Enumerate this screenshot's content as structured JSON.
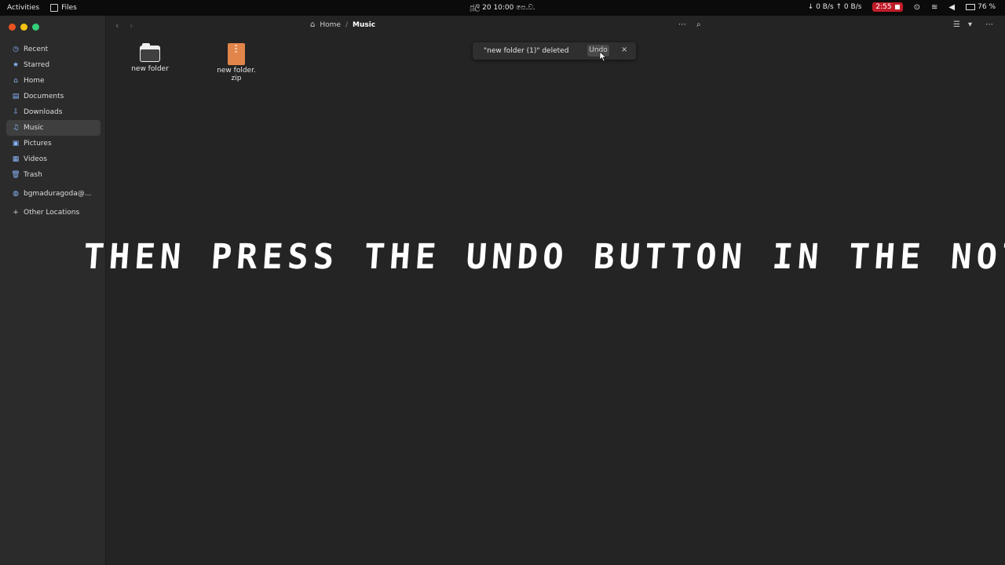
{
  "topbar": {
    "activities": "Activities",
    "app_name": "Files",
    "clock": "ජූලි 20  10:00 පෙ.ව.",
    "net_speed": "↓ 0 B/s  ↑ 0 B/s",
    "rec_time": "2:55",
    "battery": "76 %"
  },
  "sidebar": {
    "items": [
      {
        "label": "Recent",
        "icon": "clock-icon"
      },
      {
        "label": "Starred",
        "icon": "star-icon"
      },
      {
        "label": "Home",
        "icon": "home-icon"
      },
      {
        "label": "Documents",
        "icon": "document-icon"
      },
      {
        "label": "Downloads",
        "icon": "download-icon"
      },
      {
        "label": "Music",
        "icon": "music-icon",
        "active": true
      },
      {
        "label": "Pictures",
        "icon": "picture-icon"
      },
      {
        "label": "Videos",
        "icon": "video-icon"
      },
      {
        "label": "Trash",
        "icon": "trash-icon"
      }
    ],
    "account": "bgmaduragoda@...",
    "other_locations": "Other Locations"
  },
  "path": {
    "home": "Home",
    "separator": "/",
    "current": "Music"
  },
  "files": [
    {
      "name": "new folder",
      "type": "folder"
    },
    {
      "name_line1": "new folder.",
      "name_line2": "zip",
      "type": "archive"
    }
  ],
  "toast": {
    "message": "\"new folder (1)\" deleted",
    "undo_label": "Undo",
    "close_label": "×"
  },
  "caption": {
    "main": "THEN PRESS THE UNDO BUTTON IN THE NOTIFICATI",
    "tail1": "O",
    "tail2": "N"
  },
  "colors": {
    "background": "#242424",
    "sidebar": "#2b2b2b",
    "topbar": "#0b0b0b",
    "recording": "#c01c28",
    "zip": "#e2854a"
  }
}
